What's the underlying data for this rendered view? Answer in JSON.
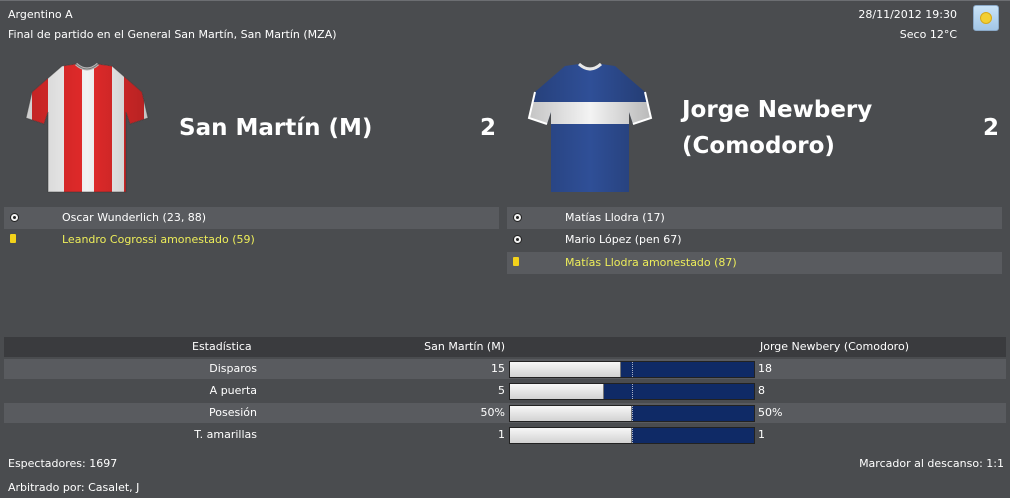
{
  "competition": "Argentino A",
  "datetime": "28/11/2012 19:30",
  "match_summary": "Final de partido en el General San Martín, San Martín (MZA)",
  "weather": {
    "text": "Seco 12°C",
    "icon": "sun-icon"
  },
  "home": {
    "name": "San Martín (M)",
    "score": "2",
    "shirt_colors": {
      "primary": "#ffffff",
      "stripe": "#e12a2a"
    },
    "events": [
      {
        "type": "goal",
        "icon": "ball-icon",
        "text": "Oscar Wunderlich (23, 88)"
      },
      {
        "type": "card",
        "icon": "yellow-card-icon",
        "text": "Leandro Cogrossi amonestado (59)"
      }
    ]
  },
  "away": {
    "name_line1": "Jorge Newbery",
    "name_line2": "(Comodoro)",
    "score": "2",
    "shirt_colors": {
      "primary": "#2f4f97",
      "band": "#ffffff"
    },
    "events": [
      {
        "type": "goal",
        "icon": "ball-icon",
        "text": "Matías Llodra (17)"
      },
      {
        "type": "goal",
        "icon": "ball-icon",
        "text": "Mario López (pen 67)"
      },
      {
        "type": "card",
        "icon": "yellow-card-icon",
        "text": "Matías Llodra amonestado (87)"
      }
    ]
  },
  "stats": {
    "header": {
      "label": "Estadística",
      "home": "San Martín (M)",
      "away": "Jorge Newbery (Comodoro)"
    },
    "rows": [
      {
        "label": "Disparos",
        "home": "15",
        "away": "18",
        "home_share": 0.455
      },
      {
        "label": "A puerta",
        "home": "5",
        "away": "8",
        "home_share": 0.385
      },
      {
        "label": "Posesión",
        "home": "50%",
        "away": "50%",
        "home_share": 0.5
      },
      {
        "label": "T. amarillas",
        "home": "1",
        "away": "1",
        "home_share": 0.5
      }
    ]
  },
  "footer": {
    "spectators": "Espectadores: 1697",
    "halftime": "Marcador al descanso: 1:1",
    "referee": "Arbitrado por: Casalet, J"
  },
  "colors": {
    "background": "#4a4c4f",
    "row_shade": "#595b5f",
    "card_text": "#eded5a",
    "bar_away": "#0f2a66",
    "bar_home": "#e6e6e6"
  }
}
